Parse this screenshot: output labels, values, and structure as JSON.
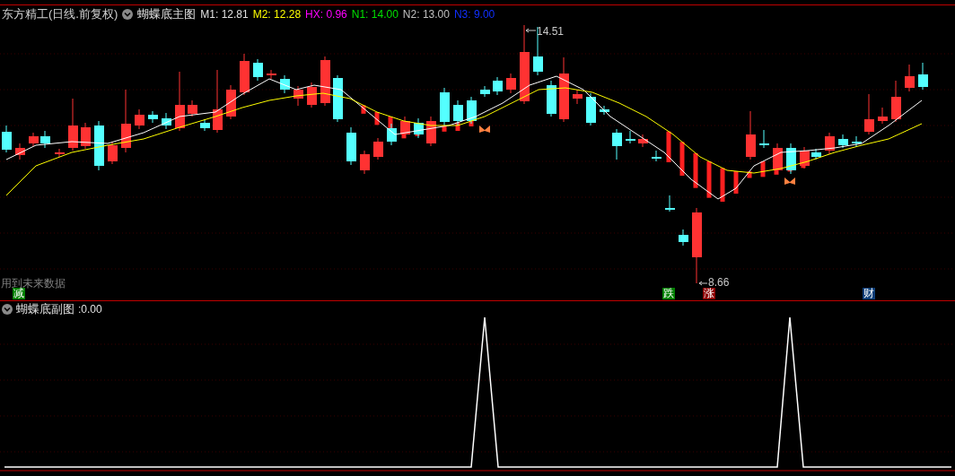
{
  "stock_title": "东方精工(日线.前复权)",
  "main_indicator": {
    "name": "蝴蝶底主图",
    "values": [
      {
        "label": "M1:",
        "value": "12.81",
        "color": "#e0e0e0"
      },
      {
        "label": "M2:",
        "value": "12.28",
        "color": "#ffff00"
      },
      {
        "label": "HX:",
        "value": "0.96",
        "color": "#ff00ff"
      },
      {
        "label": "N1:",
        "value": "14.00",
        "color": "#00e000"
      },
      {
        "label": "N2:",
        "value": "13.00",
        "color": "#c0c0c0"
      },
      {
        "label": "N3:",
        "value": "9.00",
        "color": "#1030ff"
      }
    ]
  },
  "price_marks": [
    {
      "kind": "high",
      "text": "14.51"
    },
    {
      "kind": "low",
      "text": "8.66"
    }
  ],
  "warning": "用到未来数据",
  "signal_tags": [
    {
      "text": "减",
      "color": "#008000"
    },
    {
      "text": "跌",
      "color": "#008000"
    },
    {
      "text": "涨",
      "color": "#8b0000"
    },
    {
      "text": "财",
      "color": "#0a3d78"
    }
  ],
  "sub_indicator": {
    "name": "蝴蝶底副图",
    "value": ":0.00"
  }
}
